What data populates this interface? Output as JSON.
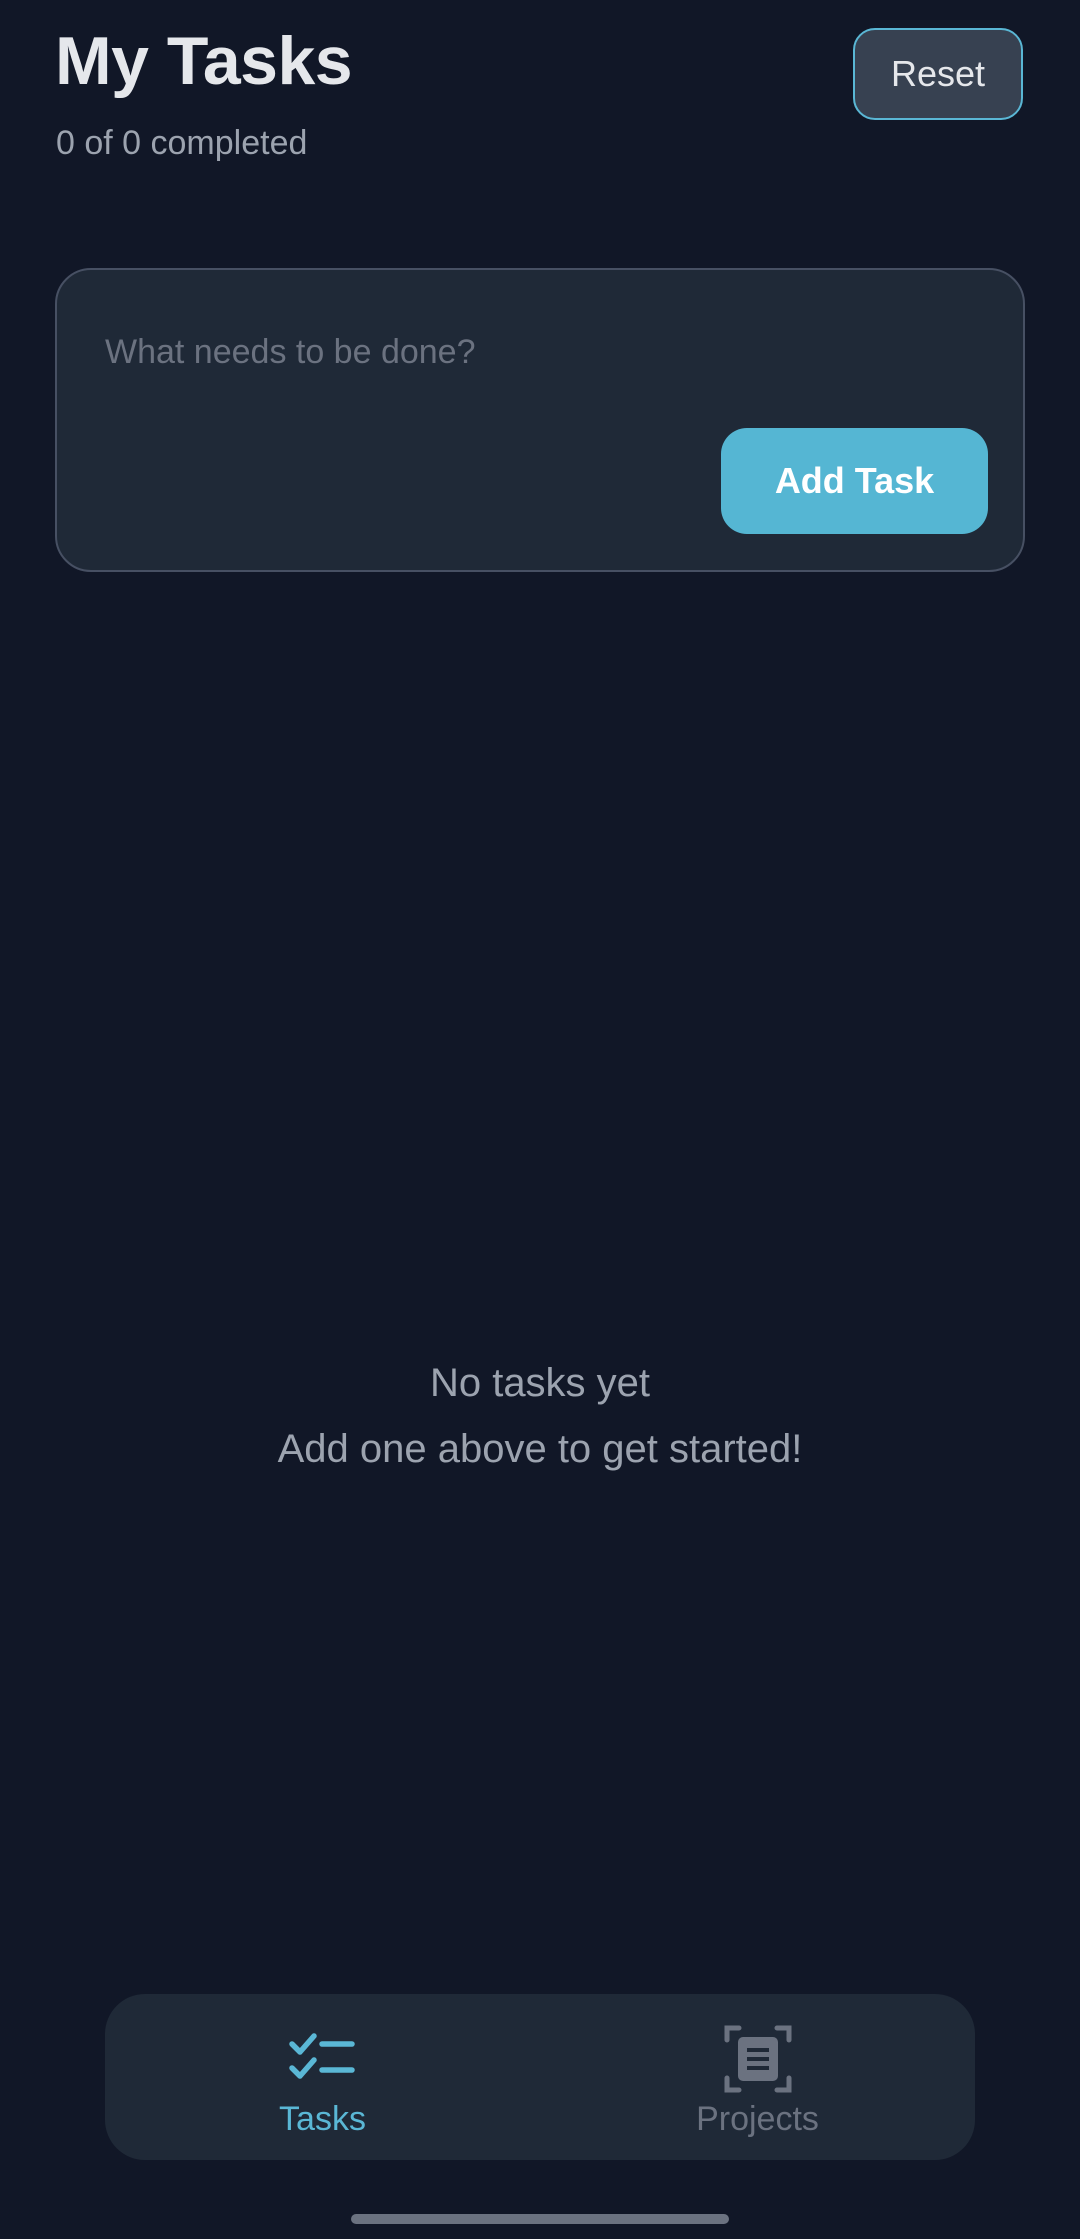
{
  "header": {
    "title": "My Tasks",
    "progress_text": "0 of 0 completed",
    "reset_label": "Reset"
  },
  "composer": {
    "input_value": "",
    "placeholder": "What needs to be done?",
    "add_label": "Add Task"
  },
  "empty_state": {
    "line1": "No tasks yet",
    "line2": "Add one above to get started!"
  },
  "bottom_nav": {
    "items": [
      {
        "label": "Tasks",
        "icon": "checklist-icon",
        "active": true
      },
      {
        "label": "Projects",
        "icon": "document-frame-icon",
        "active": false
      }
    ]
  },
  "colors": {
    "background": "#111727",
    "surface": "#1f2937",
    "accent": "#5ab7d5",
    "muted_text": "#9ca3af",
    "inactive": "#6b7280"
  }
}
